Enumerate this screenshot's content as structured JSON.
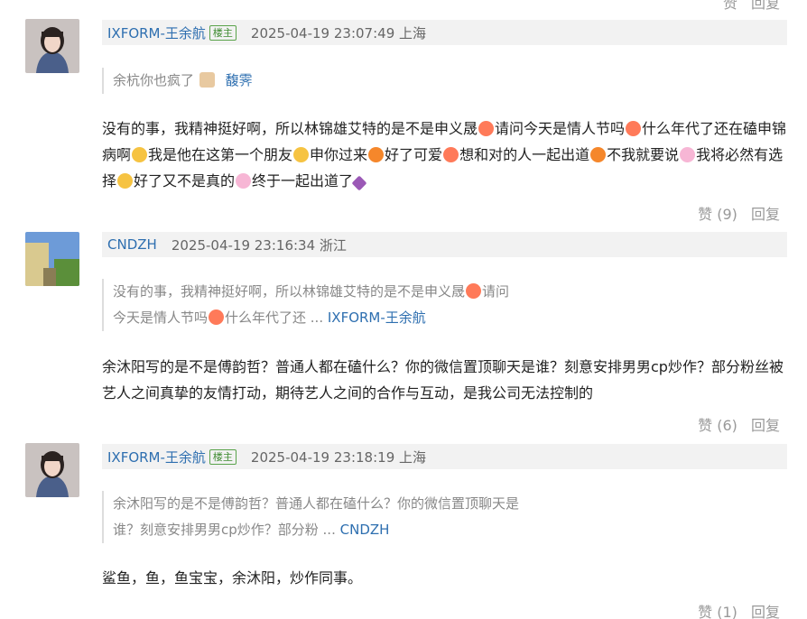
{
  "top_actions": {
    "like": "赞",
    "reply": "回复"
  },
  "comments": [
    {
      "user": "IXFORM-王余航",
      "badge": "楼主",
      "time": "2025-04-19 23:07:49 上海",
      "quote": {
        "text": "余杭你也疯了",
        "author": "馥霁"
      },
      "body_parts": [
        "没有的事，我精神挺好啊，所以林锦雄艾特的是不是申义晟",
        "请问今天是情人节吗",
        "什么年代了还在磕申锦病啊",
        "我是他在这第一个朋友",
        "申你过来",
        "好了可爱",
        "想和对的人一起出道",
        "不我就要说",
        "我将必然有选择",
        "好了又不是真的",
        "终于一起出道了"
      ],
      "like": "赞 (9)",
      "reply": "回复"
    },
    {
      "user": "CNDZH",
      "time": "2025-04-19 23:16:34 浙江",
      "quote": {
        "line1": "没有的事，我精神挺好啊，所以林锦雄艾特的是不是申义晟",
        "line1_tail": "请问",
        "line2": "今天是情人节吗",
        "line2_tail": "什么年代了还 ...",
        "author": "IXFORM-王余航"
      },
      "body": "余沐阳写的是不是傅韵哲？普通人都在磕什么？你的微信置顶聊天是谁？刻意安排男男cp炒作？部分粉丝被艺人之间真挚的友情打动，期待艺人之间的合作与互动，是我公司无法控制的",
      "like": "赞 (6)",
      "reply": "回复"
    },
    {
      "user": "IXFORM-王余航",
      "badge": "楼主",
      "time": "2025-04-19 23:18:19 上海",
      "quote": {
        "line1": "余沐阳写的是不是傅韵哲？普通人都在磕什么？你的微信置顶聊天是",
        "line2": "谁？刻意安排男男cp炒作？部分粉 ...",
        "author": "CNDZH"
      },
      "body": "鲨鱼，鱼，鱼宝宝，余沐阳，炒作同事。",
      "like": "赞 (1)",
      "reply": "回复"
    }
  ]
}
